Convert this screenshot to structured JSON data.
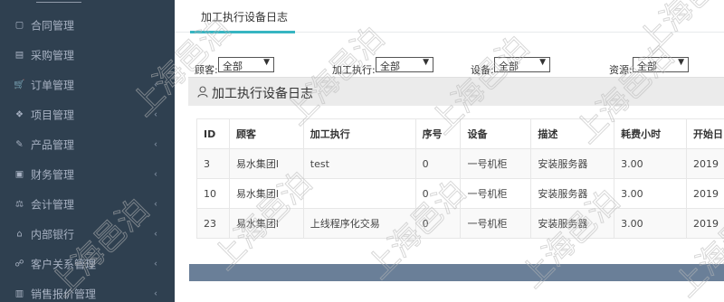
{
  "sidebar": {
    "items": [
      {
        "label": "合同管理",
        "icon": "file-icon",
        "has_arrow": false
      },
      {
        "label": "采购管理",
        "icon": "inbox-icon",
        "has_arrow": false
      },
      {
        "label": "订单管理",
        "icon": "cart-icon",
        "has_arrow": true
      },
      {
        "label": "项目管理",
        "icon": "cubes-icon",
        "has_arrow": true
      },
      {
        "label": "产品管理",
        "icon": "edit-icon",
        "has_arrow": true
      },
      {
        "label": "财务管理",
        "icon": "money-icon",
        "has_arrow": true
      },
      {
        "label": "会计管理",
        "icon": "balance-icon",
        "has_arrow": true
      },
      {
        "label": "内部银行",
        "icon": "bank-icon",
        "has_arrow": true
      },
      {
        "label": "客户关系管理",
        "icon": "users-icon",
        "has_arrow": true
      },
      {
        "label": "销售报价管理",
        "icon": "chart-icon",
        "has_arrow": true
      }
    ],
    "arrow_glyph": "‹"
  },
  "tabs": [
    {
      "label": "加工执行设备日志",
      "active": true
    }
  ],
  "filters": [
    {
      "label": "顾客:",
      "value": "全部"
    },
    {
      "label": "加工执行:",
      "value": "全部"
    },
    {
      "label": "设备:",
      "value": "全部"
    },
    {
      "label": "资源:",
      "value": "全部"
    }
  ],
  "panel": {
    "title": "加工执行设备日志",
    "icon": "user-icon"
  },
  "table": {
    "columns": [
      "ID",
      "顾客",
      "加工执行",
      "序号",
      "设备",
      "描述",
      "耗费小时",
      "开始日"
    ],
    "rows": [
      [
        "3",
        "易水集团l",
        "test",
        "0",
        "一号机柜",
        "安装服务器",
        "3.00",
        "2019"
      ],
      [
        "10",
        "易水集团l",
        "",
        "0",
        "一号机柜",
        "安装服务器",
        "3.00",
        "2019"
      ],
      [
        "23",
        "易水集团l",
        "上线程序化交易",
        "0",
        "一号机柜",
        "安装服务器",
        "3.00",
        "2019"
      ]
    ]
  },
  "watermark": {
    "text": "上海邑泊",
    "color": "#b8b8b8"
  },
  "colors": {
    "sidebar_bg": "#2f4050",
    "accent": "#37b5c2",
    "footer_bar": "#6a7f98"
  }
}
